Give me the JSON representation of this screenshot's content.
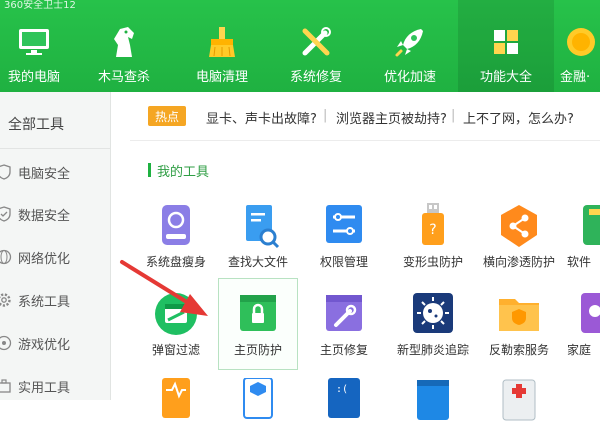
{
  "window": {
    "title": "360安全卫士12"
  },
  "nav": [
    {
      "label": "我的电脑",
      "icon": "monitor-icon"
    },
    {
      "label": "木马查杀",
      "icon": "horse-icon"
    },
    {
      "label": "电脑清理",
      "icon": "broom-icon"
    },
    {
      "label": "系统修复",
      "icon": "wrench-screwdriver-icon"
    },
    {
      "label": "优化加速",
      "icon": "rocket-icon"
    },
    {
      "label": "功能大全",
      "icon": "grid-icon",
      "active": true
    },
    {
      "label": "金融·",
      "icon": "coin-icon"
    }
  ],
  "sidebar": {
    "header": "全部工具",
    "items": [
      {
        "label": "电脑安全",
        "icon": "shield-check-icon"
      },
      {
        "label": "数据安全",
        "icon": "shield-icon"
      },
      {
        "label": "网络优化",
        "icon": "globe-icon"
      },
      {
        "label": "系统工具",
        "icon": "gear-icon"
      },
      {
        "label": "游戏优化",
        "icon": "gamepad-icon"
      },
      {
        "label": "实用工具",
        "icon": "toolbox-icon"
      }
    ]
  },
  "hot": {
    "badge": "热点",
    "links": [
      "显卡、声卡出故障?",
      "浏览器主页被劫持?",
      "上不了网，怎么办?"
    ],
    "separator": "|"
  },
  "section": {
    "title": "我的工具"
  },
  "tools_row1": [
    {
      "label": "系统盘瘦身",
      "icon": "disk-slim-icon"
    },
    {
      "label": "查找大文件",
      "icon": "file-search-icon"
    },
    {
      "label": "权限管理",
      "icon": "permission-sliders-icon"
    },
    {
      "label": "变形虫防护",
      "icon": "usb-guard-icon"
    },
    {
      "label": "横向渗透防护",
      "icon": "share-shield-icon"
    },
    {
      "label": "软件",
      "icon": "software-icon"
    }
  ],
  "tools_row2": [
    {
      "label": "弹窗过滤",
      "icon": "popup-filter-icon"
    },
    {
      "label": "主页防护",
      "icon": "homepage-lock-icon",
      "selected": true
    },
    {
      "label": "主页修复",
      "icon": "homepage-repair-icon"
    },
    {
      "label": "新型肺炎追踪",
      "icon": "virus-icon"
    },
    {
      "label": "反勒索服务",
      "icon": "ransom-folder-icon"
    },
    {
      "label": "家庭",
      "icon": "family-icon"
    }
  ],
  "colors": {
    "brand_green": "#1fb141",
    "hot_orange": "#f5a623",
    "arrow_red": "#e53935"
  }
}
